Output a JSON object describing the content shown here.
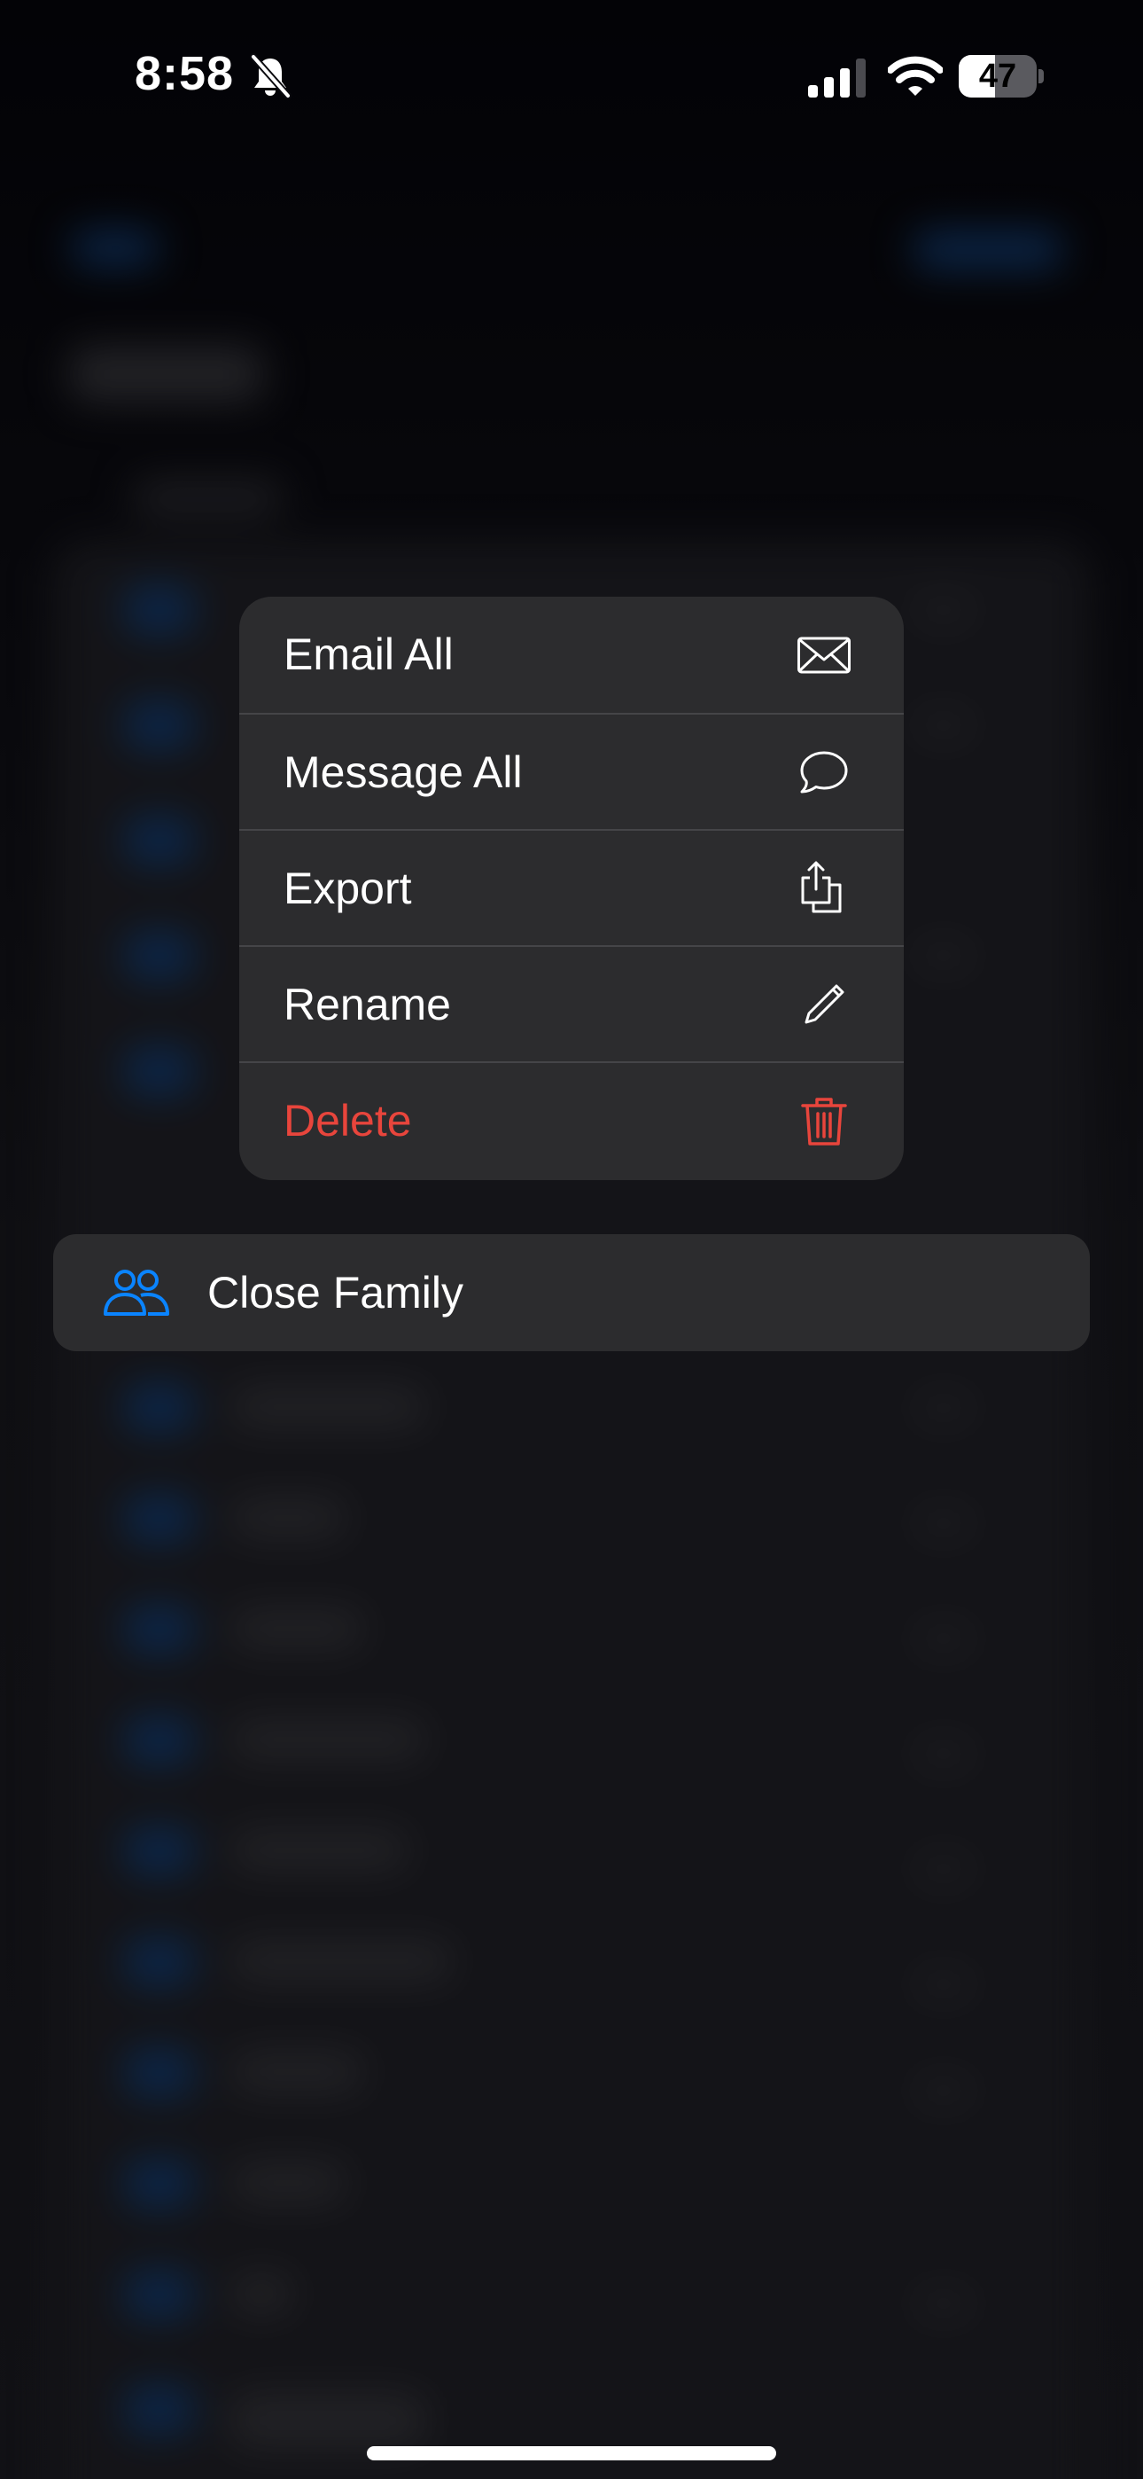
{
  "status_bar": {
    "time": "8:58",
    "mute_icon": "bell-slash-icon",
    "signal_icon": "cellular-signal-icon",
    "wifi_icon": "wifi-icon",
    "battery_percent": "47",
    "battery_level": 0.47
  },
  "context_menu": {
    "items": [
      {
        "label": "Email All",
        "icon": "envelope-icon"
      },
      {
        "label": "Message All",
        "icon": "speech-bubble-icon"
      },
      {
        "label": "Export",
        "icon": "share-icon"
      },
      {
        "label": "Rename",
        "icon": "pencil-icon"
      },
      {
        "label": "Delete",
        "icon": "trash-icon",
        "destructive": true
      }
    ]
  },
  "selected_group": {
    "label": "Close Family",
    "icon": "people-icon"
  },
  "colors": {
    "accent": "#0a84ff",
    "destructive": "#e8453c",
    "menu_background": "#2c2c2e"
  }
}
